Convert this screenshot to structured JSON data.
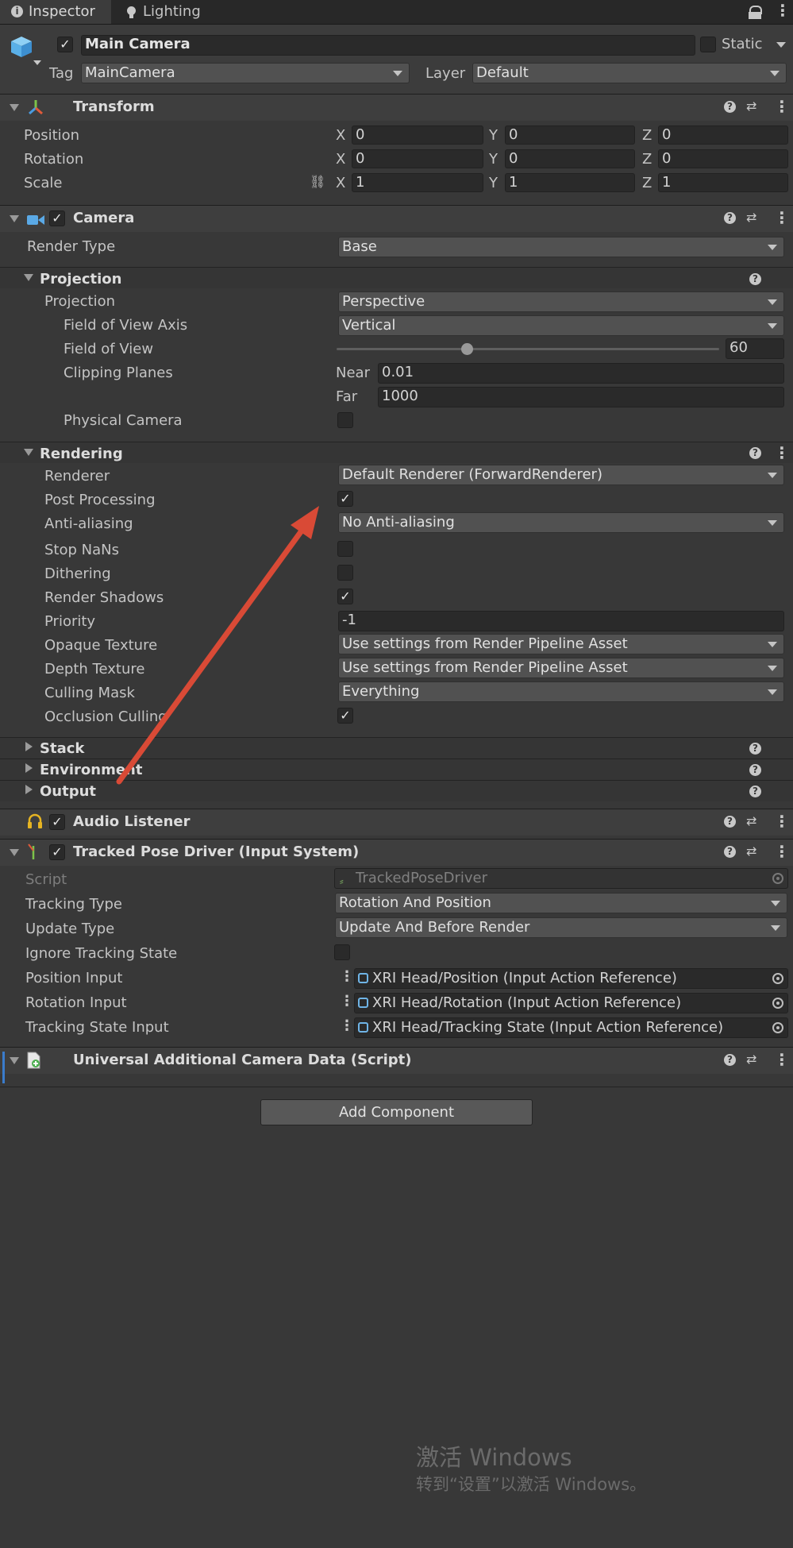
{
  "tabs": [
    {
      "label": "Inspector",
      "icon": "info-icon"
    },
    {
      "label": "Lighting",
      "icon": "lightbulb-icon"
    }
  ],
  "object": {
    "name": "Main Camera",
    "static_label": "Static",
    "tag_label": "Tag",
    "tag_value": "MainCamera",
    "layer_label": "Layer",
    "layer_value": "Default"
  },
  "transform": {
    "title": "Transform",
    "rows": [
      {
        "label": "Position",
        "x": "0",
        "y": "0",
        "z": "0"
      },
      {
        "label": "Rotation",
        "x": "0",
        "y": "0",
        "z": "0"
      },
      {
        "label": "Scale",
        "x": "1",
        "y": "1",
        "z": "1"
      }
    ],
    "axes": {
      "x": "X",
      "y": "Y",
      "z": "Z"
    }
  },
  "camera": {
    "title": "Camera",
    "render_type_label": "Render Type",
    "render_type_value": "Base",
    "projection": {
      "title": "Projection",
      "projection_label": "Projection",
      "projection_value": "Perspective",
      "fov_axis_label": "Field of View Axis",
      "fov_axis_value": "Vertical",
      "fov_label": "Field of View",
      "fov_value": "60",
      "fov_slider_fraction": 0.34,
      "clipping_label": "Clipping Planes",
      "near_label": "Near",
      "near_value": "0.01",
      "far_label": "Far",
      "far_value": "1000",
      "physical_label": "Physical Camera"
    },
    "rendering": {
      "title": "Rendering",
      "renderer_label": "Renderer",
      "renderer_value": "Default Renderer (ForwardRenderer)",
      "post_label": "Post Processing",
      "aa_label": "Anti-aliasing",
      "aa_value": "No Anti-aliasing",
      "nans_label": "Stop NaNs",
      "dither_label": "Dithering",
      "shadows_label": "Render Shadows",
      "priority_label": "Priority",
      "priority_value": "-1",
      "opaque_label": "Opaque Texture",
      "opaque_value": "Use settings from Render Pipeline Asset",
      "depth_label": "Depth Texture",
      "depth_value": "Use settings from Render Pipeline Asset",
      "culling_label": "Culling Mask",
      "culling_value": "Everything",
      "occlusion_label": "Occlusion Culling"
    },
    "stack_title": "Stack",
    "environment_title": "Environment",
    "output_title": "Output"
  },
  "audio": {
    "title": "Audio Listener"
  },
  "tracked": {
    "title": "Tracked Pose Driver (Input System)",
    "script_label": "Script",
    "script_value": "TrackedPoseDriver",
    "tracking_type_label": "Tracking Type",
    "tracking_type_value": "Rotation And Position",
    "update_type_label": "Update Type",
    "update_type_value": "Update And Before Render",
    "ignore_label": "Ignore Tracking State",
    "position_label": "Position Input",
    "position_value": "XRI Head/Position (Input Action Reference)",
    "rotation_label": "Rotation Input",
    "rotation_value": "XRI Head/Rotation (Input Action Reference)",
    "tracking_state_label": "Tracking State Input",
    "tracking_state_value": "XRI Head/Tracking State (Input Action Reference)"
  },
  "universal": {
    "title": "Universal Additional Camera Data (Script)"
  },
  "add_component_label": "Add Component",
  "watermark": {
    "line1": "激活 Windows",
    "line2": "转到“设置”以激活 Windows。"
  },
  "colors": {
    "background": "#383838",
    "annotation_arrow": "#d94a36",
    "camera_icon": "#5aa9e6",
    "audio_icon": "#e6b422"
  }
}
